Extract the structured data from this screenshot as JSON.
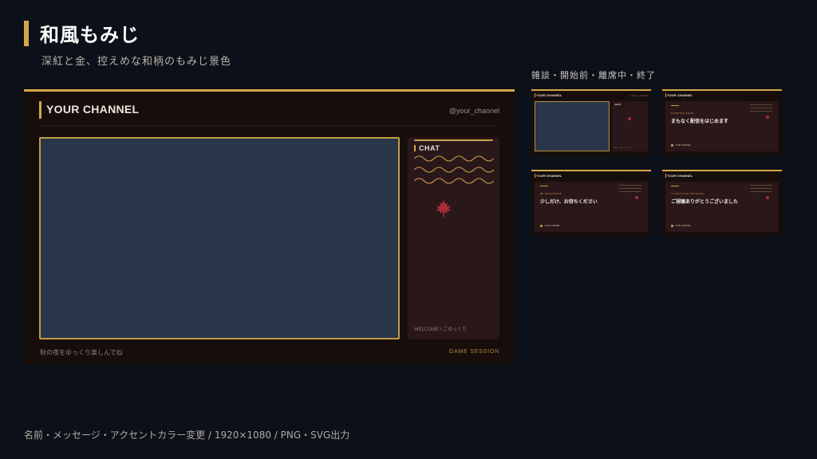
{
  "header": {
    "title": "和風もみじ",
    "subtitle": "深紅と金、控えめな和柄のもみじ景色",
    "variants_label": "雑談・開始前・離席中・終了"
  },
  "preview": {
    "channel_name": "YOUR CHANNEL",
    "handle": "@your_channel",
    "chat_title": "CHAT",
    "chat_welcome": "WELCOME / ごゆっくり",
    "caption": "秋の夜をゆっくり楽しんでね",
    "session_label": "GAME SESSION"
  },
  "thumbnails": [
    {
      "kind": "chat",
      "channel_name": "YOUR CHANNEL",
      "chat_title": "CHAT",
      "chat_welcome": "WELCOME / ごゆっくり"
    },
    {
      "kind": "message",
      "channel_name": "YOUR CHANNEL",
      "label": "STARTING SOON",
      "message": "まもなく配信をはじめます",
      "live_text": "YOUR CHANNEL"
    },
    {
      "kind": "message",
      "channel_name": "YOUR CHANNEL",
      "label": "BE RIGHT BACK",
      "message": "少しだけ、お待ちください",
      "live_text": "YOUR CHANNEL"
    },
    {
      "kind": "message",
      "channel_name": "YOUR CHANNEL",
      "label": "THANKS FOR WATCHING",
      "message": "ご視聴ありがとうございました",
      "live_text": "YOUR CHANNEL"
    }
  ],
  "footer": {
    "text": "名前・メッセージ・アクセントカラー変更 / 1920×1080 / PNG・SVG出力"
  },
  "colors": {
    "background": "#0c1119",
    "accent_gold": "#d4a84b",
    "panel_dark": "#170e0c",
    "panel_crimson": "#2a1719",
    "video_slate": "#293548",
    "maple_red": "#a72e37"
  },
  "icons": {
    "chat_decoration": "wave-pattern-icon",
    "chat_center": "maple-leaf-icon"
  }
}
